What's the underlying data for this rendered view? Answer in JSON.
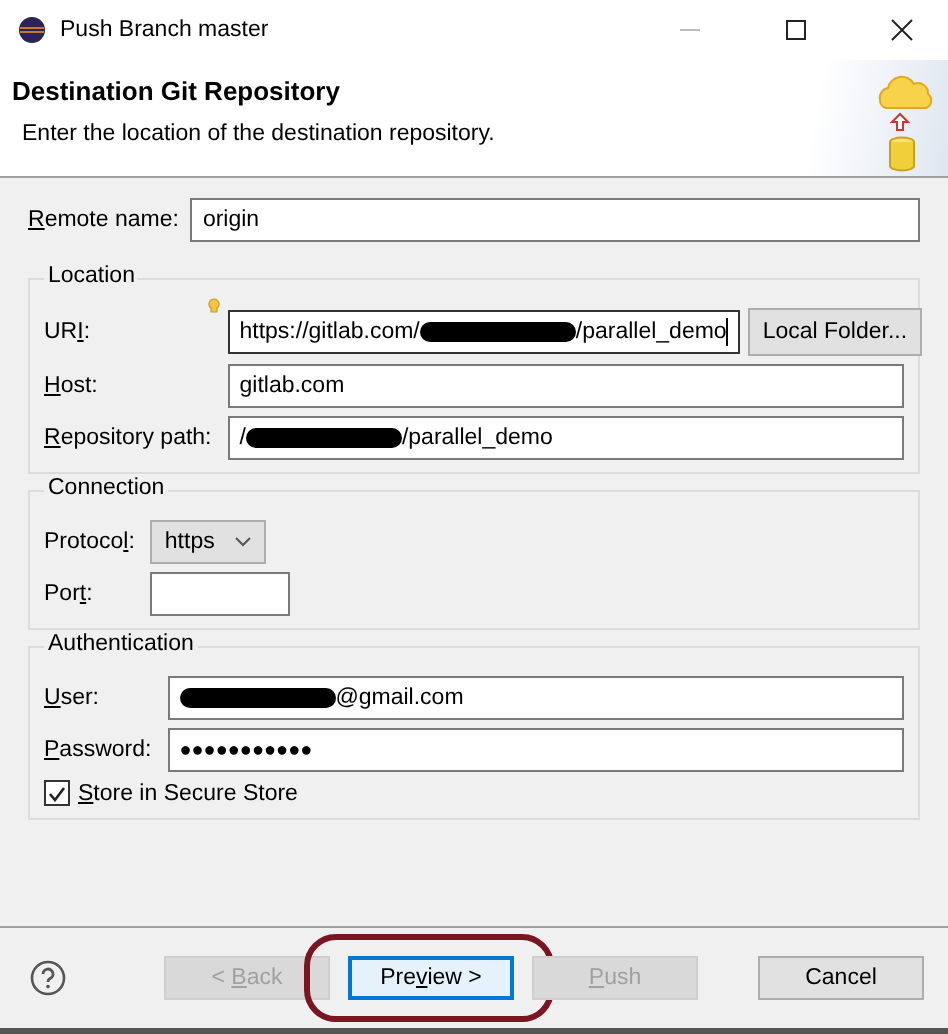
{
  "window": {
    "title": "Push Branch master"
  },
  "header": {
    "title": "Destination Git Repository",
    "description": "Enter the location of the destination repository."
  },
  "remote_name": {
    "label": {
      "key": "R",
      "post": "emote name:"
    },
    "value_before": "origin"
  },
  "groups": [
    {
      "title": "Location",
      "rows": [
        {
          "kind": "text",
          "label": {
            "pre": "UR",
            "key": "I",
            "post": ":"
          },
          "value_before": "https://gitlab.com/",
          "redacted": true,
          "value_after": "/parallel_demo",
          "focused": true,
          "assist": true,
          "button": "Local Folder..."
        },
        {
          "kind": "text",
          "label": {
            "key": "H",
            "post": "ost:"
          },
          "value_before": "gitlab.com"
        },
        {
          "kind": "text",
          "label": {
            "key": "R",
            "post": "epository path:"
          },
          "value_before": "/",
          "redacted": true,
          "value_after": "/parallel_demo"
        }
      ]
    },
    {
      "title": "Connection",
      "rows": [
        {
          "kind": "combo",
          "label": {
            "pre": "Protoco",
            "key": "l",
            "post": ":"
          },
          "value_before": "https"
        },
        {
          "kind": "number",
          "label": {
            "pre": "Por",
            "key": "t",
            "post": ":"
          }
        }
      ]
    },
    {
      "title": "Authentication",
      "rows": [
        {
          "kind": "text",
          "label": {
            "key": "U",
            "post": "ser:"
          },
          "redacted": true,
          "value_after": "@gmail.com"
        },
        {
          "kind": "password",
          "label": {
            "key": "P",
            "post": "assword:"
          },
          "value_before": "●●●●●●●●●●●"
        },
        {
          "kind": "checkbox",
          "label": {
            "key": "S",
            "post": "tore in Secure Store"
          },
          "checked": true
        }
      ]
    }
  ],
  "buttons": [
    {
      "label": {
        "pre": "< ",
        "key": "B",
        "post": "ack"
      },
      "disabled": true,
      "default": false,
      "annotated": false
    },
    {
      "label": {
        "pre": "Pre",
        "key": "v",
        "post": "iew >"
      },
      "disabled": false,
      "default": true,
      "annotated": true
    },
    {
      "label": {
        "key": "P",
        "post": "ush"
      },
      "disabled": true,
      "default": false,
      "annotated": false
    },
    {
      "label": {
        "pre": "Cancel"
      },
      "disabled": false,
      "default": false,
      "annotated": false
    }
  ]
}
